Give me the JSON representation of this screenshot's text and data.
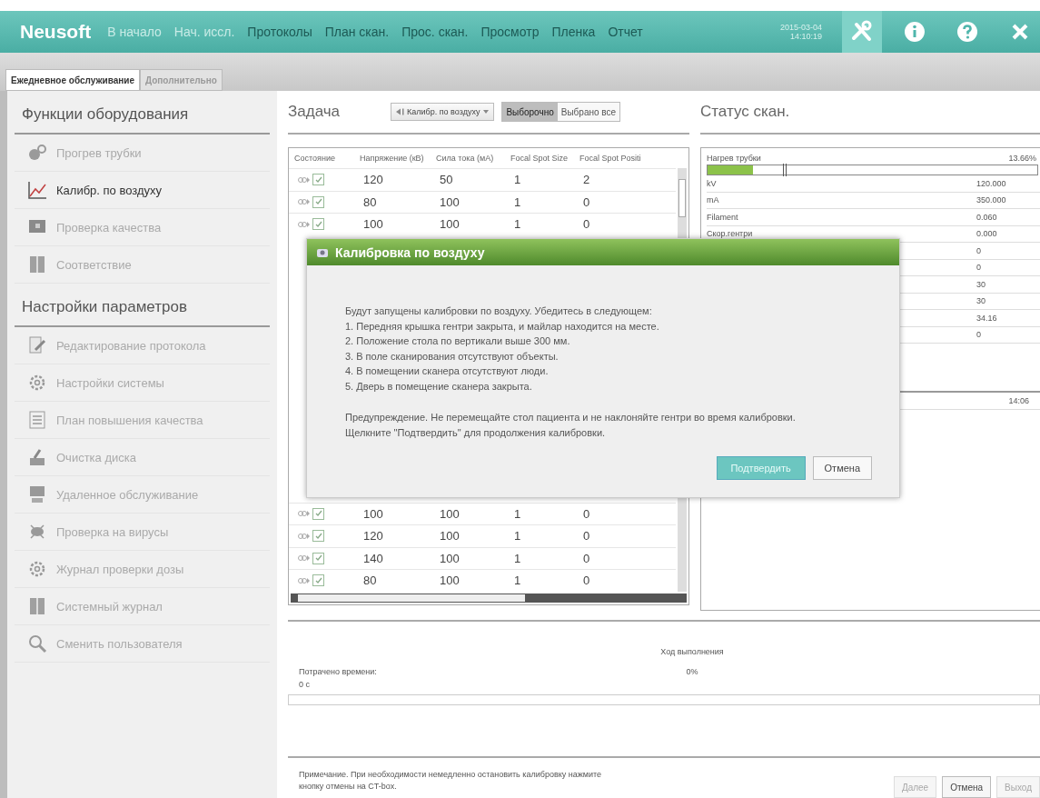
{
  "topbar": {
    "logo": "Neusoft",
    "nav": [
      {
        "label": "В начало",
        "disabled": true
      },
      {
        "label": "Нач. иссл.",
        "disabled": true
      },
      {
        "label": "Протоколы",
        "disabled": false
      },
      {
        "label": "План скан.",
        "disabled": false
      },
      {
        "label": "Прос. скан.",
        "disabled": false
      },
      {
        "label": "Просмотр",
        "disabled": false
      },
      {
        "label": "Пленка",
        "disabled": false
      },
      {
        "label": "Отчет",
        "disabled": false
      }
    ],
    "date": "2015-03-04",
    "time": "14:10:19",
    "tools": [
      {
        "kind": "tools",
        "selected": true
      },
      {
        "kind": "info",
        "selected": false
      },
      {
        "kind": "help",
        "selected": false
      },
      {
        "kind": "close",
        "selected": false
      }
    ]
  },
  "tabs": [
    {
      "label": "Ежедневное обслуживание",
      "selected": true
    },
    {
      "label": "Дополнительно",
      "selected": false
    }
  ],
  "sidebar": [
    {
      "title": "Функции оборудования",
      "items": [
        {
          "label": "Прогрев трубки",
          "kind": "tube",
          "selected": false
        },
        {
          "label": "Калибр. по воздуху",
          "kind": "chart",
          "selected": true
        },
        {
          "label": "Проверка качества",
          "kind": "monitor",
          "selected": false
        },
        {
          "label": "Соответствие",
          "kind": "book",
          "selected": false
        }
      ]
    },
    {
      "title": "Настройки параметров",
      "items": [
        {
          "label": "Редактирование протокола",
          "kind": "edit",
          "selected": false
        },
        {
          "label": "Настройки системы",
          "kind": "gear",
          "selected": false
        },
        {
          "label": "План повышения качества",
          "kind": "list",
          "selected": false
        },
        {
          "label": "Очистка диска",
          "kind": "disk",
          "selected": false
        },
        {
          "label": "Удаленное обслуживание",
          "kind": "remote",
          "selected": false
        },
        {
          "label": "Проверка на вирусы",
          "kind": "virus",
          "selected": false
        },
        {
          "label": "Журнал проверки дозы",
          "kind": "gear",
          "selected": false
        },
        {
          "label": "Системный журнал",
          "kind": "book",
          "selected": false
        },
        {
          "label": "Сменить пользователя",
          "kind": "search",
          "selected": false
        }
      ]
    }
  ],
  "task": {
    "title": "Задача",
    "dropdown": "Калибр. по воздуху",
    "modes": [
      {
        "label": "Выборочно",
        "selected": true
      },
      {
        "label": "Выбрано все",
        "selected": false
      }
    ],
    "columns": [
      "Состояние",
      "Напряжение (кВ)",
      "Сила тока (мА)",
      "Focal Spot Size",
      "Focal Spot Positi"
    ],
    "rows_top": [
      {
        "checked": true,
        "cells": [
          "120",
          "50",
          "1",
          "2"
        ]
      },
      {
        "checked": true,
        "cells": [
          "80",
          "100",
          "1",
          "0"
        ]
      },
      {
        "checked": true,
        "cells": [
          "100",
          "100",
          "1",
          "0"
        ]
      }
    ],
    "rows_bottom": [
      {
        "checked": true,
        "cells": [
          "100",
          "100",
          "1",
          "0"
        ]
      },
      {
        "checked": true,
        "cells": [
          "120",
          "100",
          "1",
          "0"
        ]
      },
      {
        "checked": true,
        "cells": [
          "140",
          "100",
          "1",
          "0"
        ]
      },
      {
        "checked": true,
        "cells": [
          "80",
          "100",
          "1",
          "0"
        ]
      }
    ]
  },
  "status": {
    "title": "Статус скан.",
    "heat": {
      "label": "Нагрев трубки",
      "reading": "13.66%",
      "level": 0.1366
    },
    "rows": [
      {
        "label": "kV",
        "value": "120.000"
      },
      {
        "label": "mA",
        "value": "350.000"
      },
      {
        "label": "Filament",
        "value": "0.060"
      },
      {
        "label": "Скор.гентри",
        "value": "0.000"
      },
      {
        "value": "0"
      },
      {
        "value": "0"
      },
      {
        "value": "30"
      },
      {
        "value": "30"
      },
      {
        "value": "34.16"
      },
      {
        "value": "0"
      }
    ],
    "rows2": [
      {
        "value": "14:06"
      }
    ]
  },
  "progress": {
    "elapsed_label": "Потрачено времени:",
    "elapsed_value": "0 с",
    "label": "Ход выполнения",
    "reading": "0%",
    "level": 0
  },
  "footer": {
    "note": "Примечание. При необходимости немедленно остановить калибровку нажмите кнопку отмены на CT-box.",
    "buttons": [
      {
        "label": "Далее",
        "disabled": true
      },
      {
        "label": "Отмена",
        "disabled": false
      },
      {
        "label": "Выход",
        "disabled": true
      }
    ]
  },
  "dialog": {
    "title": "Калибровка по воздуху",
    "intro": "Будут запущены калибровки по воздуху.  Убедитесь в следующем:",
    "items": [
      "1.  Передняя крышка гентри закрыта, и майлар находится на месте.",
      "2.  Положение стола по вертикали выше 300 мм.",
      "3.  В поле сканирования отсутствуют объекты.",
      "4.  В помещении сканера отсутствуют люди.",
      "5.  Дверь в помещение сканера закрыта."
    ],
    "warning": [
      "Предупреждение.  Не перемещайте стол пациента и не наклоняйте гентри во время калибровки.",
      "Щелкните \"Подтвердить\" для продолжения калибровки."
    ],
    "buttons": [
      {
        "label": "Подтвердить",
        "kind": "primary"
      },
      {
        "label": "Отмена",
        "kind": "secondary"
      }
    ]
  }
}
